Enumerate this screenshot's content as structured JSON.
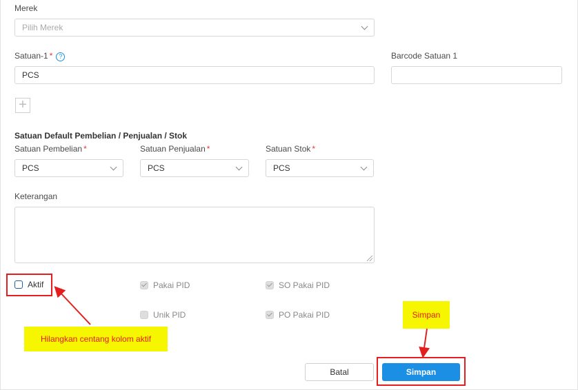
{
  "fields": {
    "brand_label": "Merek",
    "brand_placeholder": "Pilih Merek",
    "unit1_label": "Satuan-1",
    "unit1_required": "*",
    "unit1_value": "PCS",
    "barcode_label": "Barcode Satuan 1",
    "barcode_value": "",
    "default_unit_title": "Satuan Default Pembelian / Penjualan / Stok",
    "purchase_unit_label": "Satuan Pembelian",
    "purchase_unit_value": "PCS",
    "sales_unit_label": "Satuan Penjualan",
    "sales_unit_value": "PCS",
    "stock_unit_label": "Satuan Stok",
    "stock_unit_value": "PCS",
    "required_mark": "*",
    "notes_label": "Keterangan",
    "notes_value": ""
  },
  "checkboxes": {
    "active": {
      "label": "Aktif",
      "checked": false
    },
    "pakai_pid": {
      "label": "Pakai PID",
      "checked": true,
      "disabled": true
    },
    "so_pakai_pid": {
      "label": "SO Pakai PID",
      "checked": true,
      "disabled": true
    },
    "unik_pid": {
      "label": "Unik PID",
      "checked": false,
      "disabled": true
    },
    "po_pakai_pid": {
      "label": "PO Pakai PID",
      "checked": true,
      "disabled": true
    }
  },
  "buttons": {
    "cancel": "Batal",
    "save": "Simpan"
  },
  "annotations": {
    "uncheck_note": "Hilangkan centang kolom aktif",
    "save_note": "Simpan"
  },
  "icons": {
    "help": "question-circle-icon",
    "add": "plus-icon",
    "dropdown": "chevron-down-icon"
  },
  "colors": {
    "primary": "#1a8fe3",
    "annotation_red": "#e41e1e",
    "annotation_yellow": "#f6f600"
  }
}
